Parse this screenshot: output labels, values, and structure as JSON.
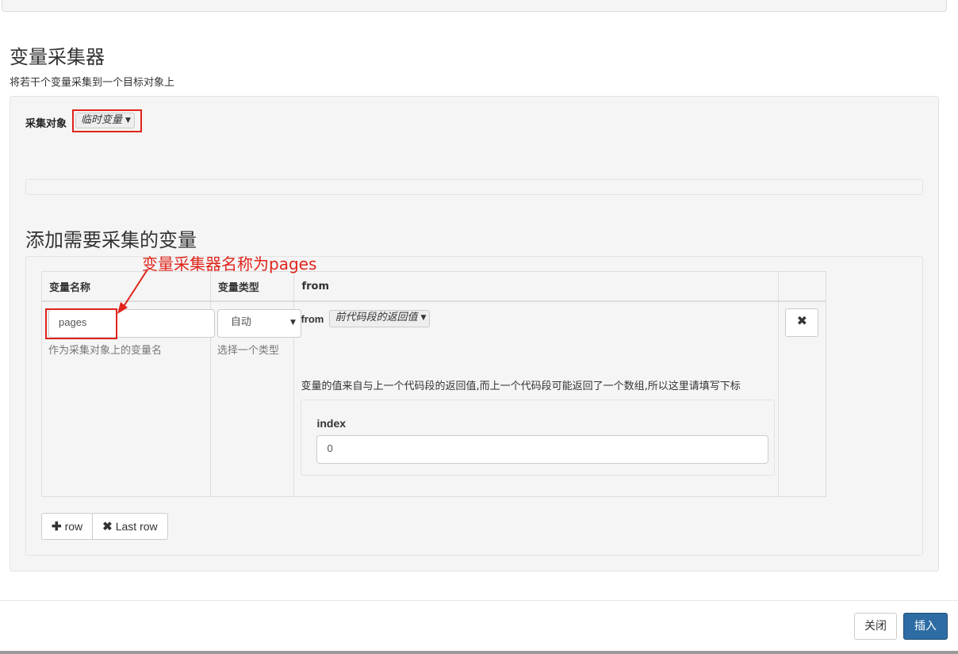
{
  "collector": {
    "title": "变量采集器",
    "description": "将若干个变量采集到一个目标对象上",
    "target_label": "采集对象",
    "target_value": "临时变量"
  },
  "add_section": {
    "title": "添加需要采集的变量"
  },
  "table": {
    "headers": [
      "变量名称",
      "变量类型",
      "from",
      ""
    ],
    "row": {
      "name_value": "pages",
      "name_help": "作为采集对象上的变量名",
      "type_value": "自动",
      "type_help": "选择一个类型",
      "from_label": "from",
      "from_value": "前代码段的返回值",
      "from_desc": "变量的值来自与上一个代码段的返回值,而上一个代码段可能返回了一个数组,所以这里请填写下标",
      "index_label": "index",
      "index_value": "0"
    }
  },
  "buttons": {
    "add_row": "row",
    "last_row": "Last row",
    "close": "关闭",
    "insert": "插入"
  },
  "annotation": {
    "text": "变量采集器名称为pages",
    "color": "#e0241b"
  },
  "icons": {
    "plus": "plus-icon",
    "remove": "remove-icon",
    "caret": "caret-down-icon"
  }
}
